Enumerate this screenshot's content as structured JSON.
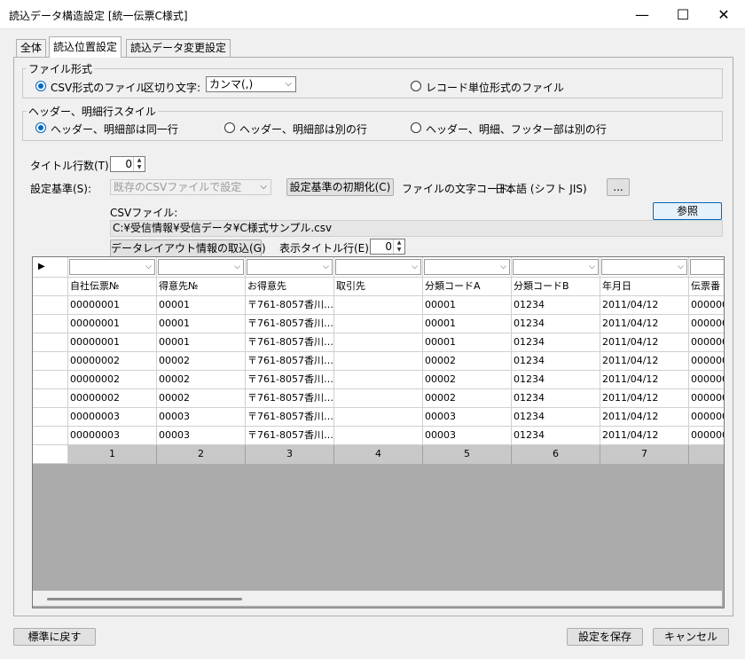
{
  "window": {
    "title": "読込データ構造設定 [統一伝票C様式]",
    "min_icon": "—",
    "max_icon": "☐",
    "close_icon": "✕"
  },
  "tabs": [
    {
      "label": "全体",
      "active": false
    },
    {
      "label": "読込位置設定",
      "active": true
    },
    {
      "label": "読込データ変更設定",
      "active": false
    }
  ],
  "file_format": {
    "group_label": "ファイル形式",
    "csv_label": "CSV形式のファイル",
    "delimiter_label": "区切り文字:",
    "delimiter_value": "カンマ(,)",
    "record_label": "レコード単位形式のファイル"
  },
  "style": {
    "group_label": "ヘッダー、明細行スタイル",
    "opt1": "ヘッダー、明細部は同一行",
    "opt2": "ヘッダー、明細部は別の行",
    "opt3": "ヘッダー、明細、フッター部は別の行"
  },
  "title_rows": {
    "label": "タイトル行数(T):",
    "value": "0"
  },
  "setting_basis": {
    "label": "設定基準(S):",
    "value": "既存のCSVファイルで設定",
    "init_button": "設定基準の初期化(C)",
    "charcode_label": "ファイルの文字コード:",
    "charcode_value": "日本語 (シフト JIS)",
    "more_button": "..."
  },
  "csv_file": {
    "label": "CSVファイル:",
    "browse_button": "参照",
    "path": "C:¥受信情報¥受信データ¥C様式サンプル.csv",
    "import_button": "データレイアウト情報の取込(G)",
    "display_title_label": "表示タイトル行(E):",
    "display_title_value": "0"
  },
  "grid": {
    "columns": [
      "自社伝票№",
      "得意先№",
      "お得意先",
      "取引先",
      "分類コードA",
      "分類コードB",
      "年月日",
      "伝票番"
    ],
    "rows": [
      [
        "00000001",
        "00001",
        "〒761-8057香川…",
        "",
        "00001",
        "01234",
        "2011/04/12",
        "000000"
      ],
      [
        "00000001",
        "00001",
        "〒761-8057香川…",
        "",
        "00001",
        "01234",
        "2011/04/12",
        "000000"
      ],
      [
        "00000001",
        "00001",
        "〒761-8057香川…",
        "",
        "00001",
        "01234",
        "2011/04/12",
        "000000"
      ],
      [
        "00000002",
        "00002",
        "〒761-8057香川…",
        "",
        "00002",
        "01234",
        "2011/04/12",
        "000000"
      ],
      [
        "00000002",
        "00002",
        "〒761-8057香川…",
        "",
        "00002",
        "01234",
        "2011/04/12",
        "000000"
      ],
      [
        "00000002",
        "00002",
        "〒761-8057香川…",
        "",
        "00002",
        "01234",
        "2011/04/12",
        "000000"
      ],
      [
        "00000003",
        "00003",
        "〒761-8057香川…",
        "",
        "00003",
        "01234",
        "2011/04/12",
        "000000"
      ],
      [
        "00000003",
        "00003",
        "〒761-8057香川…",
        "",
        "00003",
        "01234",
        "2011/04/12",
        "000000"
      ]
    ],
    "numbers": [
      "1",
      "2",
      "3",
      "4",
      "5",
      "6",
      "7",
      ""
    ]
  },
  "footer": {
    "reset_button": "標準に戻す",
    "save_button": "設定を保存",
    "cancel_button": "キャンセル"
  }
}
